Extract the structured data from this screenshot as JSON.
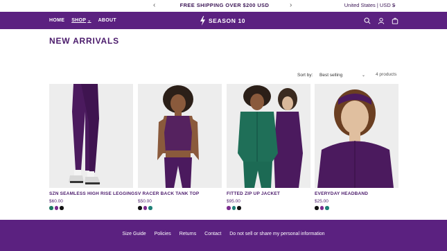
{
  "announcement": {
    "prev_glyph": "‹",
    "message": "FREE SHIPPING OVER $200 USD",
    "next_glyph": "›",
    "locale": "United States | USD $",
    "locale_chevron": "⌄"
  },
  "header": {
    "nav": [
      {
        "label": "HOME"
      },
      {
        "label": "SHOP",
        "chevron": "⌄"
      },
      {
        "label": "ABOUT"
      }
    ],
    "logo_text": "SEASON 10",
    "icons": [
      "search-icon",
      "account-icon",
      "cart-icon"
    ]
  },
  "page": {
    "title": "NEW ARRIVALS"
  },
  "sort": {
    "label": "Sort by:",
    "selected": "Best selling",
    "chevron": "⌄",
    "count": "4 products"
  },
  "colors": {
    "brand": "#5b2180",
    "text_purple": "#4a1a6b",
    "swatch_green": "#1f7a63",
    "swatch_purple": "#7b2c8f",
    "swatch_black": "#111111",
    "swatch_teal": "#1e8077"
  },
  "products": [
    {
      "name": "SZN SEAMLESS HIGH RISE LEGGINGS",
      "price": "$60.00",
      "swatches": [
        "#1f7a63",
        "#7b2c8f",
        "#111111"
      ]
    },
    {
      "name": "V RACER BACK TANK TOP",
      "price": "$50.00",
      "swatches": [
        "#111111",
        "#7b2c8f",
        "#1e8077"
      ]
    },
    {
      "name": "FITTED ZIP UP JACKET",
      "price": "$95.00",
      "swatches": [
        "#7b2c8f",
        "#1e8077",
        "#111111"
      ]
    },
    {
      "name": "EVERYDAY HEADBAND",
      "price": "$25.00",
      "swatches": [
        "#111111",
        "#7b2c8f",
        "#1e8077"
      ]
    }
  ],
  "footer": {
    "links": [
      "Size Guide",
      "Policies",
      "Returns",
      "Contact",
      "Do not sell or share my personal information"
    ]
  }
}
